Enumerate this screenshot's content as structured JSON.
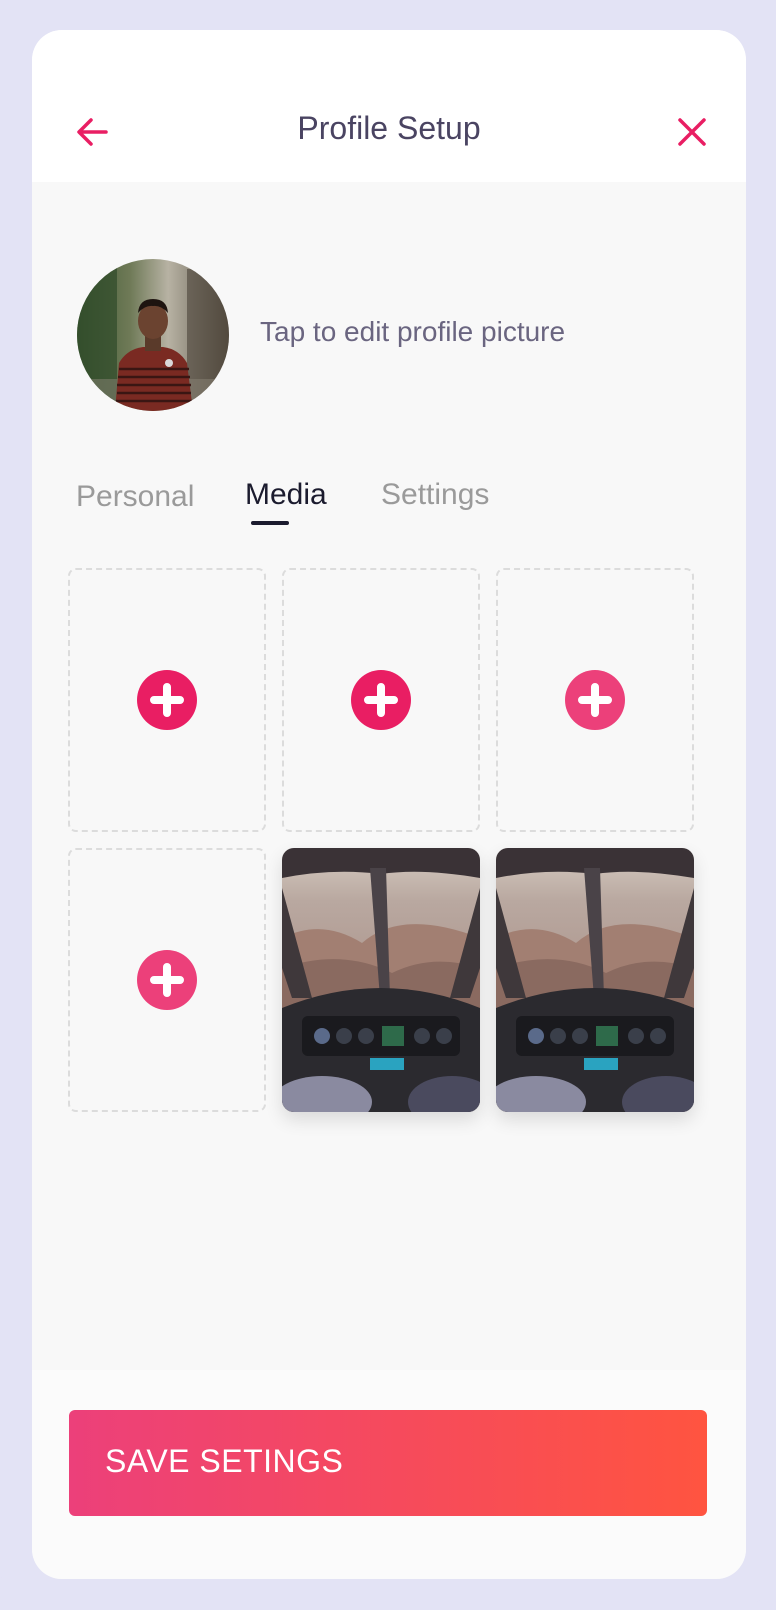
{
  "header": {
    "title": "Profile Setup",
    "back_icon": "arrow-left-icon",
    "close_icon": "close-icon"
  },
  "profile": {
    "avatar_icon": "profile-photo",
    "hint": "Tap to edit profile picture"
  },
  "tabs": [
    {
      "label": "Personal",
      "active": false
    },
    {
      "label": "Media",
      "active": true
    },
    {
      "label": "Settings",
      "active": false
    }
  ],
  "media": {
    "slots": [
      {
        "type": "empty",
        "icon": "plus-circle-icon"
      },
      {
        "type": "empty",
        "icon": "plus-circle-icon"
      },
      {
        "type": "empty",
        "icon": "plus-circle-icon"
      },
      {
        "type": "empty",
        "icon": "plus-circle-icon"
      },
      {
        "type": "photo",
        "icon": "cockpit-photo"
      },
      {
        "type": "photo",
        "icon": "cockpit-photo"
      }
    ]
  },
  "footer": {
    "save_label": "SAVE SETINGS"
  },
  "colors": {
    "accent": "#e91e63",
    "gradient_start": "#ec407a",
    "gradient_end": "#ff5440",
    "title": "#4a4462",
    "frame": "#e3e3f5"
  }
}
